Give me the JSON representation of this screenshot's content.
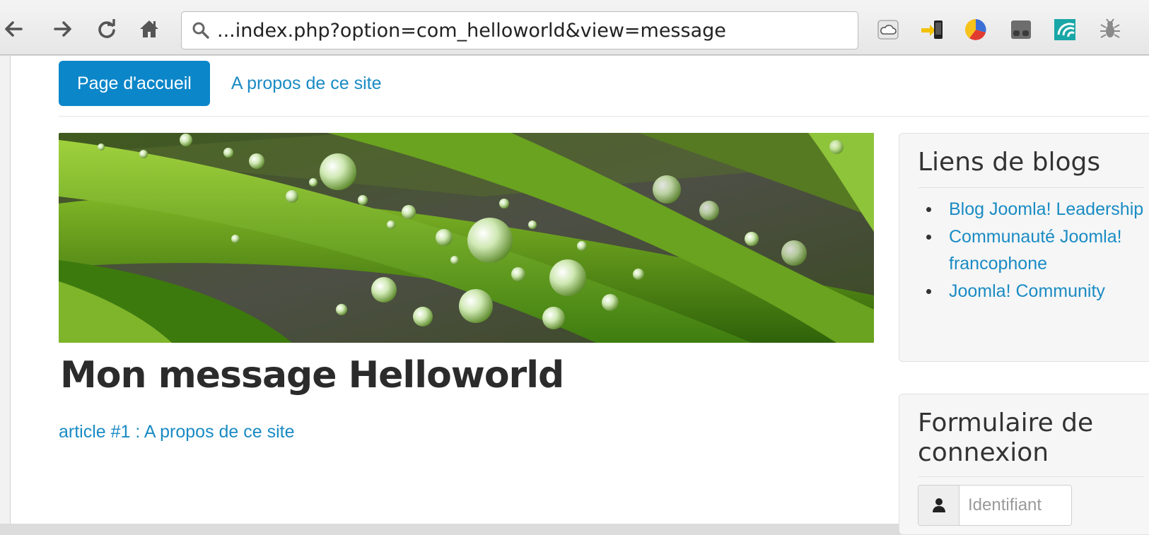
{
  "browser": {
    "url": "...index.php?option=com_helloworld&view=message",
    "back_icon": "back-arrow-icon",
    "forward_icon": "forward-arrow-icon",
    "reload_icon": "reload-icon",
    "home_icon": "home-icon",
    "extensions": [
      "weather-cloud-icon",
      "send-to-mobile-icon",
      "color-pie-icon",
      "mask-icon",
      "wave-icon",
      "bug-icon"
    ]
  },
  "nav": {
    "home_label": "Page d'accueil",
    "about_label": "A propos de ce site"
  },
  "main": {
    "title": "Mon message Helloworld",
    "article_link": "article #1 : A propos de ce site"
  },
  "sidebar": {
    "blogs": {
      "title": "Liens de blogs",
      "items": [
        {
          "label": "Blog Joomla! Leadership"
        },
        {
          "label": "Communauté Joomla! francophone"
        },
        {
          "label": "Joomla! Community"
        }
      ]
    },
    "login": {
      "title": "Formulaire de connexion",
      "username_placeholder": "Identifiant"
    }
  },
  "colors": {
    "accent": "#0b86c9",
    "link": "#1a8bc4"
  }
}
